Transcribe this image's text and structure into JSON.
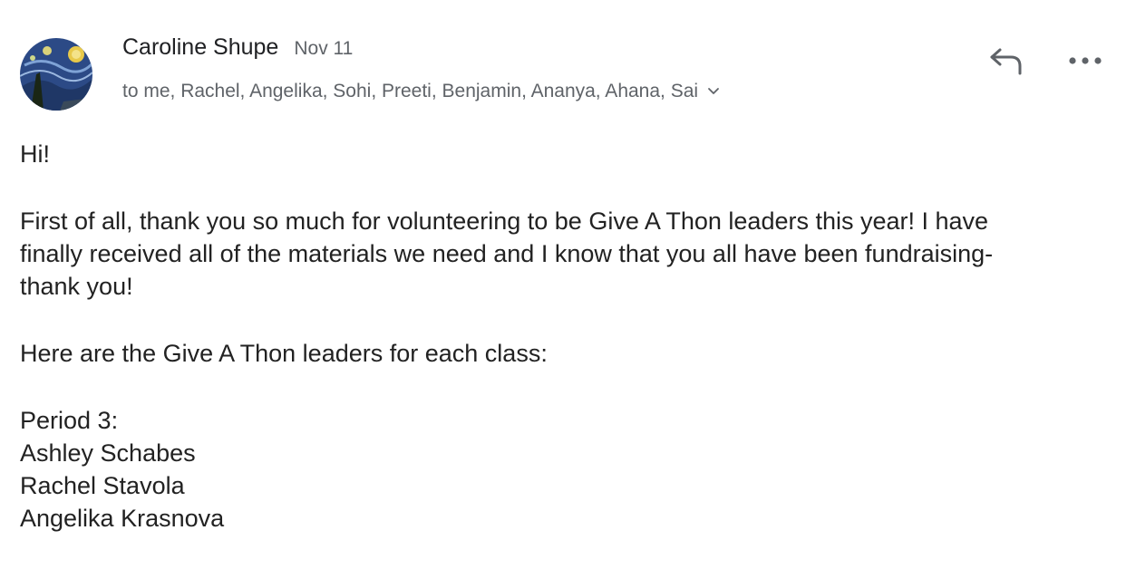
{
  "message": {
    "sender": "Caroline Shupe",
    "date": "Nov 11",
    "recipients": "to me, Rachel, Angelika, Sohi, Preeti, Benjamin, Ananya, Ahana, Sai",
    "icons": {
      "avatar": "starry-night-avatar",
      "reply": "reply-icon",
      "more": "more-options-icon",
      "expand": "chevron-down-icon"
    },
    "colors": {
      "secondary_text": "#5f6368",
      "body_text": "#222222",
      "icon": "#5f6368"
    }
  },
  "body": {
    "greeting": "Hi!",
    "paragraph1_line1": "First of all, thank you so much for volunteering to be Give A Thon leaders this year! I have",
    "paragraph1_line2": "finally received all of the materials we need and I know that you all have been fundraising-",
    "paragraph1_line3": "thank you!",
    "paragraph2": "Here are the Give A Thon leaders for each class:",
    "period_heading": "Period 3:",
    "leaders": [
      "Ashley Schabes",
      "Rachel Stavola",
      "Angelika Krasnova"
    ]
  }
}
